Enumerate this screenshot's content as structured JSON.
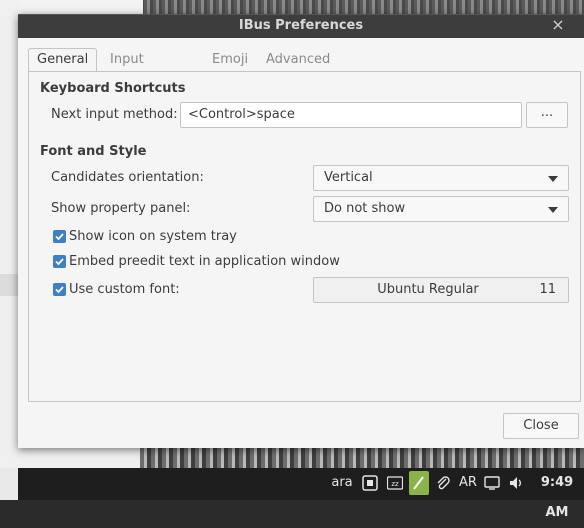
{
  "window": {
    "title": "IBus Preferences"
  },
  "tabs": [
    {
      "label": "General",
      "active": true
    },
    {
      "label": "Input Method",
      "active": false
    },
    {
      "label": "Emoji",
      "active": false
    },
    {
      "label": "Advanced",
      "active": false
    }
  ],
  "keyboard_shortcuts": {
    "heading": "Keyboard Shortcuts",
    "next_input_label": "Next input method:",
    "next_input_value": "<Control>space",
    "browse_label": "..."
  },
  "font_style": {
    "heading": "Font and Style",
    "orientation_label": "Candidates orientation:",
    "orientation_value": "Vertical",
    "panel_label": "Show property panel:",
    "panel_value": "Do not show",
    "show_icon_label": "Show icon on system tray",
    "show_icon_checked": true,
    "embed_label": "Embed preedit text in application window",
    "embed_checked": true,
    "custom_font_label": "Use custom font:",
    "custom_font_checked": true,
    "font_name": "Ubuntu Regular",
    "font_size": "11"
  },
  "footer": {
    "close_label": "Close"
  },
  "taskbar": {
    "lang": "ara",
    "keyboard_layout": "AR",
    "time": "9:49 AM",
    "accent_color": "#8ab34a"
  }
}
